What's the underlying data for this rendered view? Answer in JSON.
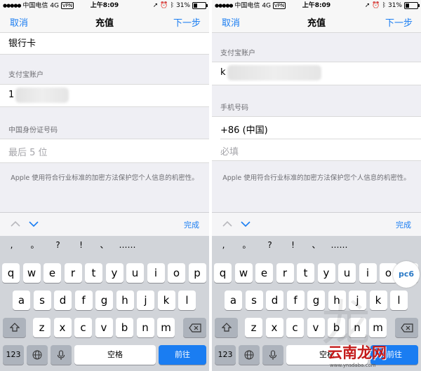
{
  "status_bar": {
    "carrier": "中国电信",
    "network": "4G",
    "vpn": "VPN",
    "time": "上午8:09",
    "battery": "31%",
    "battery_level": 0.31
  },
  "nav": {
    "cancel": "取消",
    "title": "充值",
    "next": "下一步"
  },
  "left_form": {
    "bank_card": "银行卡",
    "alipay_label": "支付宝账户",
    "alipay_value_prefix": "1",
    "id_label": "中国身份证号码",
    "id_placeholder": "最后 5 位",
    "note": "Apple 使用符合行业标准的加密方法保护您个人信息的机密性。"
  },
  "right_form": {
    "alipay_label": "支付宝账户",
    "alipay_value_prefix": "k",
    "phone_label": "手机号码",
    "country_code": "+86 (中国)",
    "phone_placeholder": "必填",
    "note": "Apple 使用符合行业标准的加密方法保护您个人信息的机密性。"
  },
  "toolbar": {
    "done": "完成"
  },
  "keyboard": {
    "punctuation": [
      ",",
      "。",
      "?",
      "!",
      "、",
      "……"
    ],
    "row1": [
      "q",
      "w",
      "e",
      "r",
      "t",
      "y",
      "u",
      "i",
      "o",
      "p"
    ],
    "row2": [
      "a",
      "s",
      "d",
      "f",
      "g",
      "h",
      "j",
      "k",
      "l"
    ],
    "row3": [
      "z",
      "x",
      "c",
      "v",
      "b",
      "n",
      "m"
    ],
    "numbers_key": "123",
    "space_key": "空格",
    "go_key": "前往"
  },
  "watermark": {
    "logo": "pc6",
    "site": "云南龙网",
    "url": "www.ynsdaba.com"
  }
}
